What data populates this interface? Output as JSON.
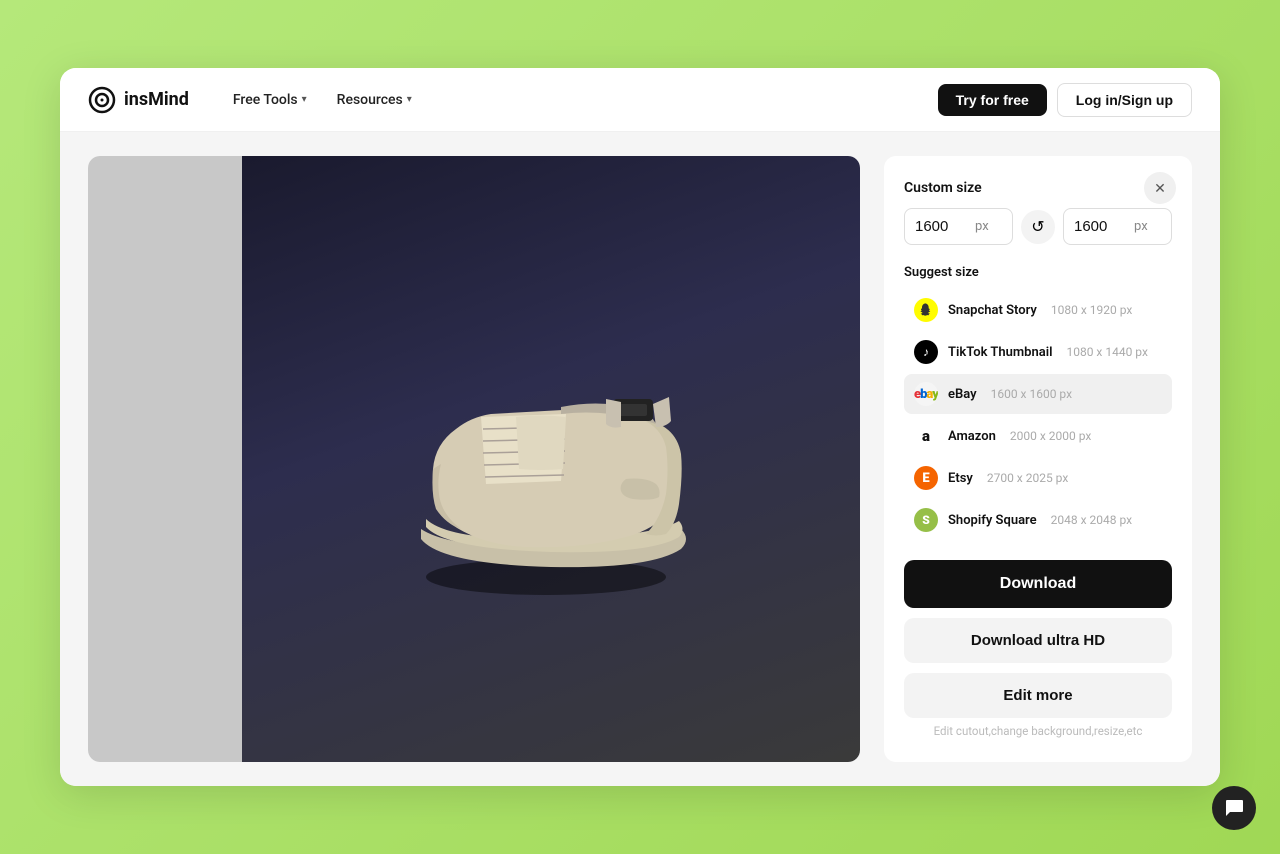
{
  "header": {
    "logo_text": "insMind",
    "nav_items": [
      {
        "label": "Free Tools",
        "has_dropdown": true
      },
      {
        "label": "Resources",
        "has_dropdown": true
      }
    ],
    "try_label": "Try for free",
    "login_label": "Log in/Sign up"
  },
  "custom_size": {
    "title": "Custom size",
    "width_value": "1600",
    "height_value": "1600",
    "unit": "px"
  },
  "suggest_size": {
    "title": "Suggest size",
    "items": [
      {
        "id": "snapchat",
        "name": "Snapchat Story",
        "size": "1080 x 1920 px",
        "icon_type": "snapchat"
      },
      {
        "id": "tiktok",
        "name": "TikTok Thumbnail",
        "size": "1080 x 1440 px",
        "icon_type": "tiktok"
      },
      {
        "id": "ebay",
        "name": "eBay",
        "size": "1600 x 1600 px",
        "icon_type": "ebay",
        "active": true
      },
      {
        "id": "amazon",
        "name": "Amazon",
        "size": "2000 x 2000 px",
        "icon_type": "amazon"
      },
      {
        "id": "etsy",
        "name": "Etsy",
        "size": "2700 x 2025 px",
        "icon_type": "etsy"
      },
      {
        "id": "shopify",
        "name": "Shopify Square",
        "size": "2048 x 2048 px",
        "icon_type": "shopify"
      }
    ]
  },
  "buttons": {
    "download": "Download",
    "download_hd": "Download ultra HD",
    "edit": "Edit more",
    "edit_hint": "Edit cutout,change background,resize,etc"
  },
  "colors": {
    "accent": "#111111",
    "background": "#a8e063",
    "panel_bg": "#ffffff"
  }
}
